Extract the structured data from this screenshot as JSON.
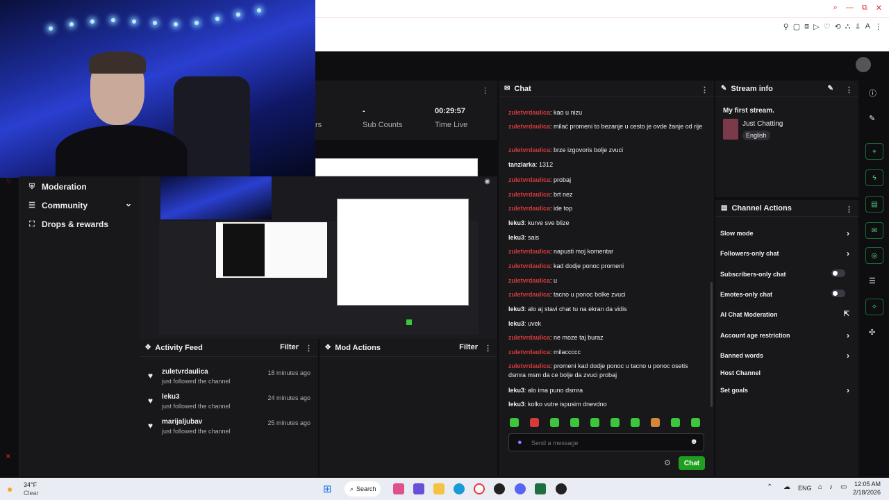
{
  "browser": {
    "window_controls": [
      "⌕",
      "—",
      "⧉",
      "✕"
    ],
    "toolbar_icons": [
      "⚲",
      "▢",
      "⧈",
      "▷",
      "♡",
      "⟲",
      "⛬",
      "⇩",
      "A",
      "⋮"
    ]
  },
  "sidebar": {
    "items": [
      {
        "label": "Moderation",
        "icon": "shield-icon"
      },
      {
        "label": "Community",
        "icon": "community-icon",
        "chevron": "⌄"
      },
      {
        "label": "Drops & rewards",
        "icon": "gift-icon"
      }
    ]
  },
  "stats": {
    "partial": "rs",
    "sub_count_value": "-",
    "sub_count_label": "Sub Counts",
    "live_time_value": "00:29:57",
    "live_time_label": "Time Live"
  },
  "activity_feed": {
    "title": "Activity Feed",
    "filter_label": "Filter",
    "items": [
      {
        "name": "zuletvrdaulica",
        "action": "just followed the channel",
        "time": "18 minutes ago"
      },
      {
        "name": "leku3",
        "action": "just followed the channel",
        "time": "24 minutes ago"
      },
      {
        "name": "marijaljubav",
        "action": "just followed the channel",
        "time": "25 minutes ago"
      }
    ]
  },
  "mod_actions": {
    "title": "Mod Actions",
    "filter_label": "Filter"
  },
  "chat": {
    "title": "Chat",
    "messages": [
      {
        "user": "zuletvrdaulica",
        "text": "kao u nizu",
        "color": "#d63a3a"
      },
      {
        "user": "zuletvrdaulica",
        "text": "milać promeni to bezanje u cesto je ovde žanje od rije",
        "color": "#d63a3a"
      },
      {
        "user": "zuletvrdaulica",
        "text": "brze izgovoris bolje zvuci",
        "color": "#d63a3a"
      },
      {
        "user": "tanzlarka",
        "text": "1312",
        "color": "#f0f0f0"
      },
      {
        "user": "zuletvrdaulica",
        "text": "probaj",
        "color": "#d63a3a"
      },
      {
        "user": "zuletvrdaulica",
        "text": "brt nez",
        "color": "#d63a3a"
      },
      {
        "user": "zuletvrdaulica",
        "text": "ide top",
        "color": "#d63a3a"
      },
      {
        "user": "leku3",
        "text": "kurve sve blize",
        "color": "#f0f0f0"
      },
      {
        "user": "leku3",
        "text": "sais",
        "color": "#f0f0f0"
      },
      {
        "user": "zuletvrdaulica",
        "text": "napusti moj komentar",
        "color": "#d63a3a"
      },
      {
        "user": "zuletvrdaulica",
        "text": "kad dodje ponoc promeni",
        "color": "#d63a3a"
      },
      {
        "user": "zuletvrdaulica",
        "text": "u",
        "color": "#d63a3a"
      },
      {
        "user": "zuletvrdaulica",
        "text": "tacno u ponoc bolke zvuci",
        "color": "#d63a3a"
      },
      {
        "user": "leku3",
        "text": "alo aj stavi chat tu na ekran da vidis",
        "color": "#f0f0f0"
      },
      {
        "user": "leku3",
        "text": "uvek",
        "color": "#f0f0f0"
      },
      {
        "user": "zuletvrdaulica",
        "text": "ne moze taj buraz",
        "color": "#d63a3a"
      },
      {
        "user": "zuletvrdaulica",
        "text": "milaccccc",
        "color": "#d63a3a"
      },
      {
        "user": "zuletvrdaulica",
        "text": "promeni kad dodje ponoc u tacno u ponoc osetis dsmra msm da ce bolje da zvuci probaj",
        "color": "#d63a3a"
      },
      {
        "user": "leku3",
        "text": "alo ima puno dsmra",
        "color": "#f0f0f0"
      },
      {
        "user": "leku3",
        "text": "kolko vutre ispusim dnevdno",
        "color": "#f0f0f0"
      }
    ],
    "input_placeholder": "Send a message",
    "send_label": "Chat"
  },
  "stream_info": {
    "title": "Stream info",
    "stream_title": "My first stream.",
    "category": "Just Chatting",
    "language": "English"
  },
  "channel_actions": {
    "title": "Channel Actions",
    "items": [
      {
        "label": "Slow mode",
        "control": "arrow"
      },
      {
        "label": "Followers-only chat",
        "control": "arrow"
      },
      {
        "label": "Subscribers-only chat",
        "control": "toggle"
      },
      {
        "label": "Emotes-only chat",
        "control": "toggle"
      },
      {
        "label": "AI Chat Moderation",
        "control": "external"
      },
      {
        "label": "Account age restriction",
        "control": "arrow"
      },
      {
        "label": "Banned words",
        "control": "arrow"
      },
      {
        "label": "Host Channel",
        "control": "none"
      },
      {
        "label": "Set goals",
        "control": "arrow"
      }
    ]
  },
  "taskbar": {
    "weather_temp": "34°F",
    "weather_desc": "Clear",
    "search_label": "Search",
    "lang": "ENG",
    "time": "12:05 AM",
    "date": "2/18/2026"
  },
  "colors": {
    "accent_green": "#1f9e1f",
    "username_red": "#d63a3a",
    "panel_bg": "#18181b"
  }
}
